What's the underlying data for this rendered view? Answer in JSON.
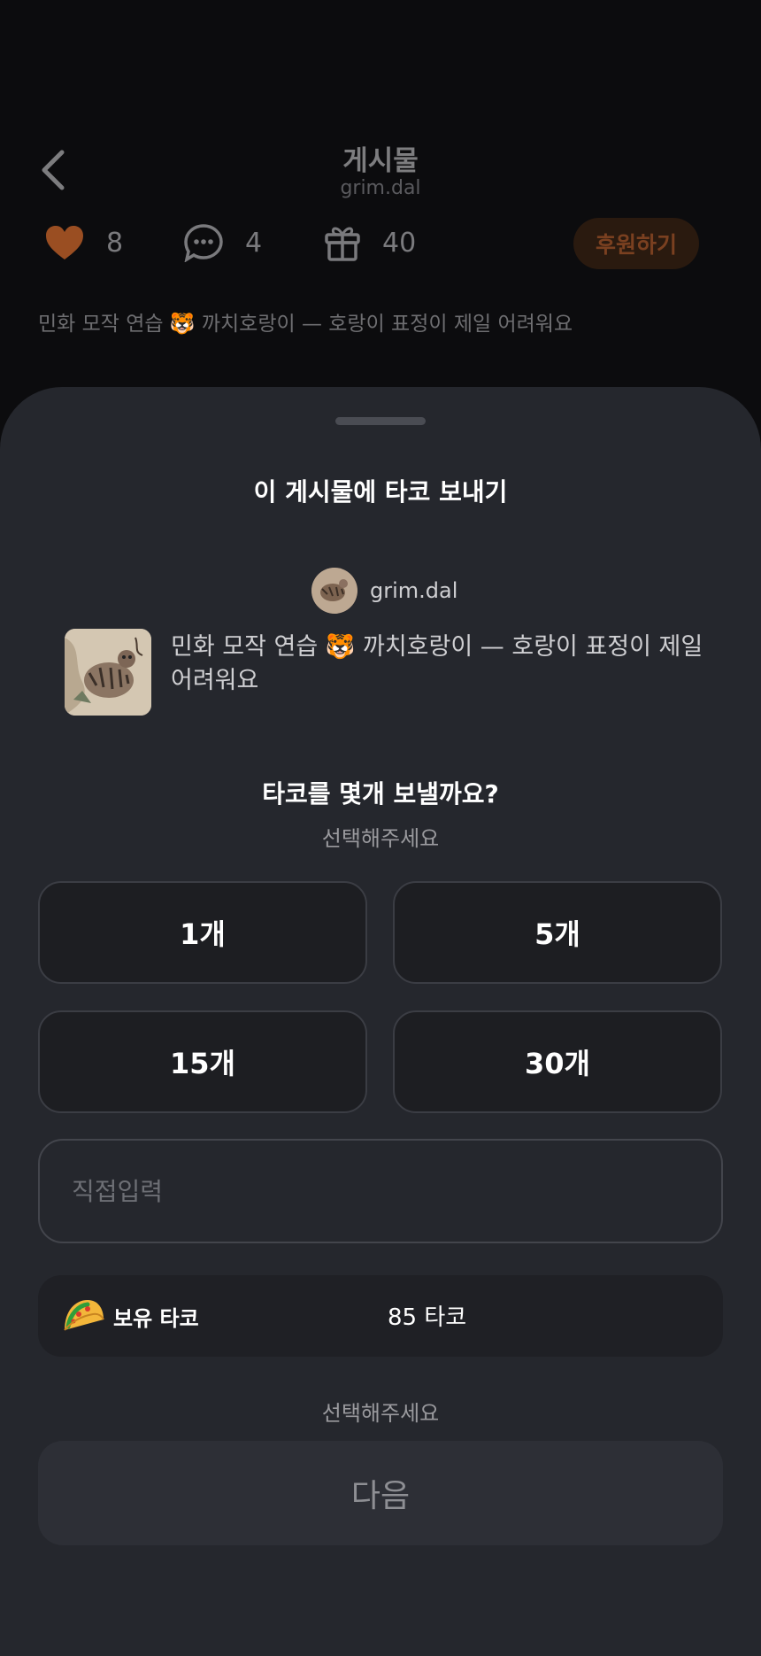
{
  "header": {
    "title": "게시물",
    "subtitle": "grim.dal"
  },
  "stats": {
    "likes": "8",
    "comments": "4",
    "gifts": "40",
    "donate_label": "후원하기"
  },
  "post": {
    "caption": "민화 모작 연습 🐯 까치호랑이 — 호랑이 표정이 제일 어려워요"
  },
  "sheet": {
    "title": "이 게시물에 타코 보내기",
    "author_name": "grim.dal",
    "post_text": "민화 모작 연습 🐯 까치호랑이 — 호랑이 표정이 제일 어려워요",
    "question": "타코를 몇개 보낼까요?",
    "question_sub": "선택해주세요",
    "options": [
      "1개",
      "5개",
      "15개",
      "30개"
    ],
    "custom_placeholder": "직접입력",
    "balance_label": "보유 타코",
    "balance_value": "85 타코",
    "hint": "선택해주세요",
    "next_label": "다음"
  },
  "colors": {
    "accent": "#b5622c",
    "sheet_bg": "#25272d",
    "option_bg": "#1d1e22"
  }
}
